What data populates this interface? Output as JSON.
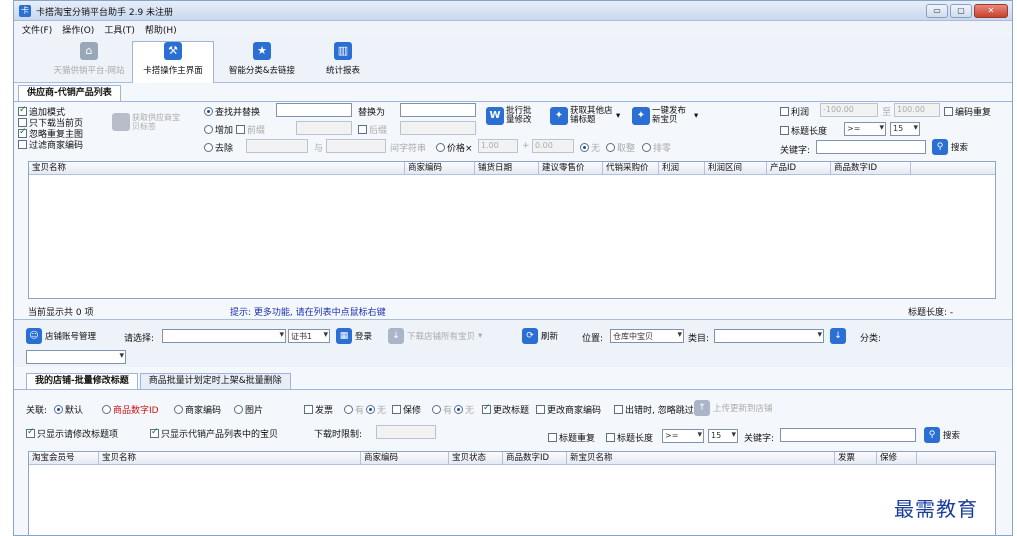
{
  "window": {
    "title": "卡搭淘宝分销平台助手 2.9 未注册",
    "min": "▭",
    "max": "▢",
    "close": "✕"
  },
  "menu": [
    "文件(F)",
    "操作(O)",
    "工具(T)",
    "帮助(H)"
  ],
  "toolbar": [
    {
      "label": "天猫供销平台-网站",
      "icon": "home-icon",
      "glyph": "⌂",
      "color": "#9aa7b8",
      "disabled": true
    },
    {
      "label": "卡搭操作主界面",
      "icon": "hammer-icon",
      "glyph": "⚒",
      "color": "#2b6fd4",
      "active": true
    },
    {
      "label": "智能分类&去链接",
      "icon": "star-icon",
      "glyph": "★",
      "color": "#2b6fd4"
    },
    {
      "label": "统计报表",
      "icon": "chart-icon",
      "glyph": "▥",
      "color": "#2b6fd4"
    }
  ],
  "supplier": {
    "tab": "供应商-代销产品列表",
    "options": {
      "add_mode": "追加模式",
      "download_current": "只下载当前页",
      "ignore_repeat_img": "忽略重复主图",
      "filter_merchant": "过滤商家编码"
    },
    "get_supplier_btn": "获取供应商宝贝标签",
    "radio": {
      "find_replace": "查找并替换",
      "replace_with": "替换为",
      "add": "增加",
      "prefix": "前缀",
      "suffix": "后缀",
      "remove": "去除",
      "and": "与",
      "between": "间字符串",
      "price": "价格×",
      "price_val": "1.00",
      "plus": "+",
      "zero": "0.00",
      "none": "无",
      "round_up": "取整",
      "round_units": "排零"
    },
    "btn_batch": "批行批量修改",
    "btn_get_shop": "获取其他店铺标题",
    "btn_publish": "一键发布新宝贝",
    "right": {
      "profit": "利润",
      "profit_min": "-100.00",
      "to": "至",
      "profit_max": "100.00",
      "code_repeat": "编码重复",
      "title_len": "标题长度",
      "title_len_op": ">=",
      "title_len_val": "15",
      "keyword": "关键字:",
      "search": "搜索"
    },
    "columns": [
      "宝贝名称",
      "商家编码",
      "铺货日期",
      "建议零售价",
      "代销采购价",
      "利润",
      "利润区间",
      "产品ID",
      "商品数字ID"
    ],
    "status_count": "当前显示共 0 项",
    "tip": "提示: 更多功能, 请在列表中点鼠标右键",
    "title_len_status": "标题长度: -"
  },
  "shopbar": {
    "manage": "店铺账号管理",
    "select": "请选择:",
    "cert": "证书1",
    "login": "登录",
    "download_all": "下载店铺所有宝贝",
    "refresh": "刷新",
    "position": "位置:",
    "pos_val": "仓库中宝贝",
    "category": "类目:",
    "classify": "分类:"
  },
  "myshop": {
    "tabs": [
      "我的店铺-批量修改标题",
      "商品批量计划定时上架&批量删除"
    ],
    "relation": "关联:",
    "default": "默认",
    "digital_id": "商品数字ID",
    "merchant": "商家编码",
    "image": "图片",
    "invoice": "发票",
    "yes": "有",
    "no": "无",
    "warranty": "保修",
    "change_title": "更改标题",
    "change_merchant": "更改商家编码",
    "skip_on_error": "出错时, 忽略跳过",
    "upload": "上传更新到店铺",
    "only_modified": "只显示请修改标题项",
    "only_listed": "只显示代销产品列表中的宝贝",
    "download_limit": "下载时限制:",
    "title_repeat": "标题重复",
    "title_len": "标题长度",
    "title_len_op": ">=",
    "title_len_val": "15",
    "keyword": "关键字:",
    "search": "搜索",
    "columns": [
      "淘宝会员号",
      "宝贝名称",
      "商家编码",
      "宝贝状态",
      "商品数字ID",
      "新宝贝名称",
      "发票",
      "保修"
    ]
  },
  "watermark": "最需教育"
}
